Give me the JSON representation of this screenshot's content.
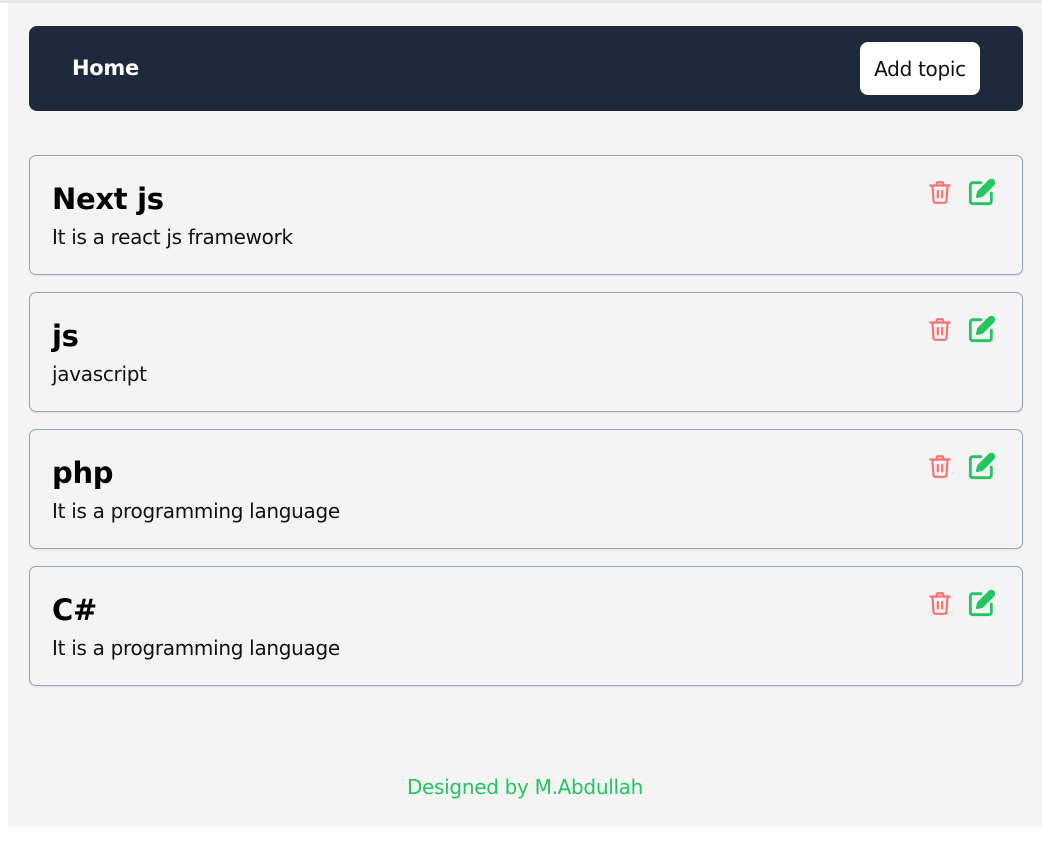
{
  "colors": {
    "navbar_bg": "#1e293b",
    "page_bg": "#f4f4f4",
    "delete_icon": "#f87171",
    "edit_icon": "#22c55e",
    "footer_text": "#22c55e"
  },
  "navbar": {
    "home_label": "Home",
    "add_topic_label": "Add topic"
  },
  "topics": [
    {
      "title": "Next js",
      "description": "It is a react js framework",
      "delete_icon": "trash-icon",
      "edit_icon": "edit-icon"
    },
    {
      "title": "js",
      "description": "javascript",
      "delete_icon": "trash-icon",
      "edit_icon": "edit-icon"
    },
    {
      "title": "php",
      "description": "It is a programming language",
      "delete_icon": "trash-icon",
      "edit_icon": "edit-icon"
    },
    {
      "title": "C#",
      "description": "It is a programming language",
      "delete_icon": "trash-icon",
      "edit_icon": "edit-icon"
    }
  ],
  "footer": {
    "text": "Designed by M.Abdullah"
  }
}
